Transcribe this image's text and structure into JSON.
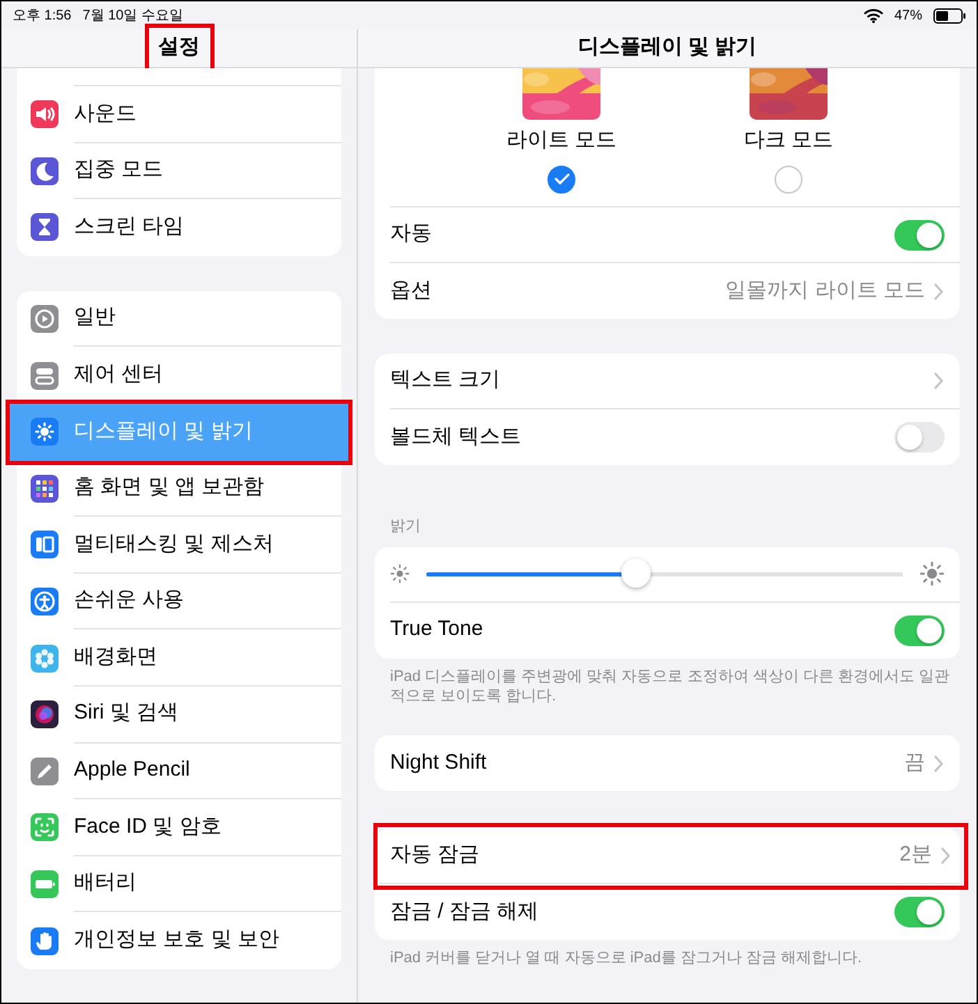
{
  "status_bar": {
    "time": "오후 1:56",
    "date": "7월 10일 수요일",
    "battery": "47%"
  },
  "sidebar": {
    "title": "설정",
    "title_annotated": true,
    "groups": [
      {
        "items": [
          {
            "label": "사운드",
            "color": "#f0395a",
            "selected": false,
            "annotated": false
          },
          {
            "label": "집중 모드",
            "color": "#5b56d6",
            "selected": false,
            "annotated": false
          },
          {
            "label": "스크린 타임",
            "color": "#5b56d6",
            "selected": false,
            "annotated": false
          }
        ]
      },
      {
        "items": [
          {
            "label": "일반",
            "color": "#8e8e93",
            "selected": false,
            "annotated": false
          },
          {
            "label": "제어 센터",
            "color": "#8e8e93",
            "selected": false,
            "annotated": false
          },
          {
            "label": "디스플레이 및 밝기",
            "color": "#1a7cf5",
            "selected": true,
            "annotated": true
          },
          {
            "label": "홈 화면 및 앱 보관함",
            "color": "#5b56d6",
            "selected": false,
            "annotated": false
          },
          {
            "label": "멀티태스킹 및 제스처",
            "color": "#1a7cf5",
            "selected": false,
            "annotated": false
          },
          {
            "label": "손쉬운 사용",
            "color": "#1a7cf5",
            "selected": false,
            "annotated": false
          },
          {
            "label": "배경화면",
            "color": "#3fb4ec",
            "selected": false,
            "annotated": false
          },
          {
            "label": "Siri 및 검색",
            "color": "#2a1f3d",
            "selected": false,
            "annotated": false
          },
          {
            "label": "Apple Pencil",
            "color": "#8e8e93",
            "selected": false,
            "annotated": false
          },
          {
            "label": "Face ID 및 암호",
            "color": "#35c759",
            "selected": false,
            "annotated": false
          },
          {
            "label": "배터리",
            "color": "#35c759",
            "selected": false,
            "annotated": false
          },
          {
            "label": "개인정보 보호 및 보안",
            "color": "#1a7cf5",
            "selected": false,
            "annotated": false
          }
        ]
      }
    ]
  },
  "detail": {
    "title": "디스플레이 및 밝기",
    "sections": [
      {
        "appearance": [
          {
            "label": "라이트 모드",
            "selected": true
          },
          {
            "label": "다크 모드",
            "selected": false
          }
        ],
        "rows": [
          {
            "kind": "toggle",
            "label": "자동",
            "on": true,
            "annotated": false
          },
          {
            "kind": "link",
            "label": "옵션",
            "value": "일몰까지 라이트 모드",
            "annotated": false
          }
        ]
      },
      {
        "rows": [
          {
            "kind": "link",
            "label": "텍스트 크기",
            "annotated": false
          },
          {
            "kind": "toggle",
            "label": "볼드체 텍스트",
            "on": false,
            "annotated": false
          }
        ]
      },
      {
        "header": "밝기",
        "rows": [
          {
            "kind": "slider",
            "level": 0.44,
            "annotated": false
          },
          {
            "kind": "toggle",
            "label": "True Tone",
            "on": true,
            "annotated": false
          }
        ],
        "footer": "iPad 디스플레이를 주변광에 맞춰 자동으로 조정하여 색상이 다른 환경에서도 일관적으로 보이도록 합니다."
      },
      {
        "rows": [
          {
            "kind": "link",
            "label": "Night Shift",
            "value": "끔",
            "annotated": false
          }
        ]
      },
      {
        "rows": [
          {
            "kind": "link",
            "label": "자동 잠금",
            "value": "2분",
            "annotated": true
          },
          {
            "kind": "toggle",
            "label": "잠금 / 잠금 해제",
            "on": true,
            "annotated": false
          }
        ],
        "footer": "iPad 커버를 닫거나 열 때 자동으로 iPad를 잠그거나 잠금 해제합니다."
      }
    ]
  }
}
